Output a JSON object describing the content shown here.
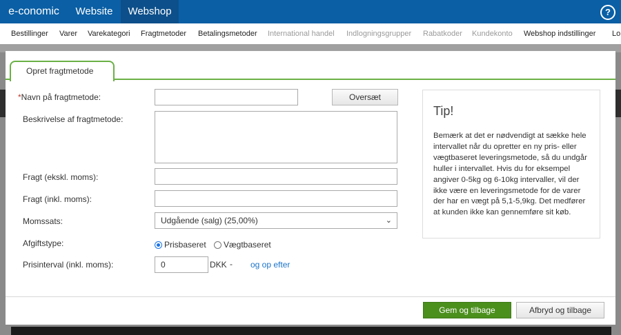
{
  "topbar": {
    "brand": "e-conomic",
    "tabs": [
      "Website",
      "Webshop"
    ],
    "help_label": "?"
  },
  "subnav": {
    "items": [
      {
        "label": "Bestillinger"
      },
      {
        "label": "Varer"
      },
      {
        "label": "Varekategori"
      },
      {
        "label": "Fragtmetoder"
      },
      {
        "label": "Betalingsmetoder"
      },
      {
        "label": "International handel"
      },
      {
        "label": "Indlogningsgrupper"
      },
      {
        "label": "Rabatkoder"
      },
      {
        "label": "Kundekonto"
      },
      {
        "label": "Webshop indstillinger"
      },
      {
        "label": "Lo"
      }
    ]
  },
  "modal": {
    "tab_label": "Opret fragtmetode",
    "form": {
      "name_required_mark": "*",
      "name_label": "Navn på fragtmetode:",
      "name_value": "",
      "translate_button": "Oversæt",
      "description_label": "Beskrivelse af fragtmetode:",
      "description_value": "",
      "freight_excl_label": "Fragt (ekskl. moms):",
      "freight_excl_value": "",
      "freight_incl_label": "Fragt (inkl. moms):",
      "freight_incl_value": "",
      "vat_label": "Momssats:",
      "vat_selected": "Udgående (salg) (25,00%)",
      "charge_type_label": "Afgiftstype:",
      "charge_type_options": [
        "Prisbaseret",
        "Vægtbaseret"
      ],
      "charge_type_selected": "Prisbaseret",
      "price_interval_label": "Prisinterval (inkl. moms):",
      "price_interval_from": "0",
      "currency": "DKK",
      "dash": "-",
      "and_up_link": "og op efter"
    },
    "tip": {
      "title": "Tip!",
      "body": "Bemærk at det er nødvendigt at sække hele intervallet når du opretter en ny pris- eller vægtbaseret leveringsmetode, så du undgår huller i intervallet. Hvis du for eksempel angiver 0-5kg og 6-10kg intervaller, vil der ikke være en leveringsmetode for de varer der har en vægt på 5,1-5,9kg. Det medfører at kunden ikke kan gennemføre sit køb."
    },
    "footer": {
      "save_button": "Gem og tilbage",
      "cancel_button": "Afbryd og tilbage"
    }
  },
  "colors": {
    "topbar": "#0a5fa5",
    "topbar_active": "#0d4f8a",
    "accent_green": "#6ab045",
    "save_green": "#4b8f1d",
    "link_blue": "#1a73c8"
  }
}
